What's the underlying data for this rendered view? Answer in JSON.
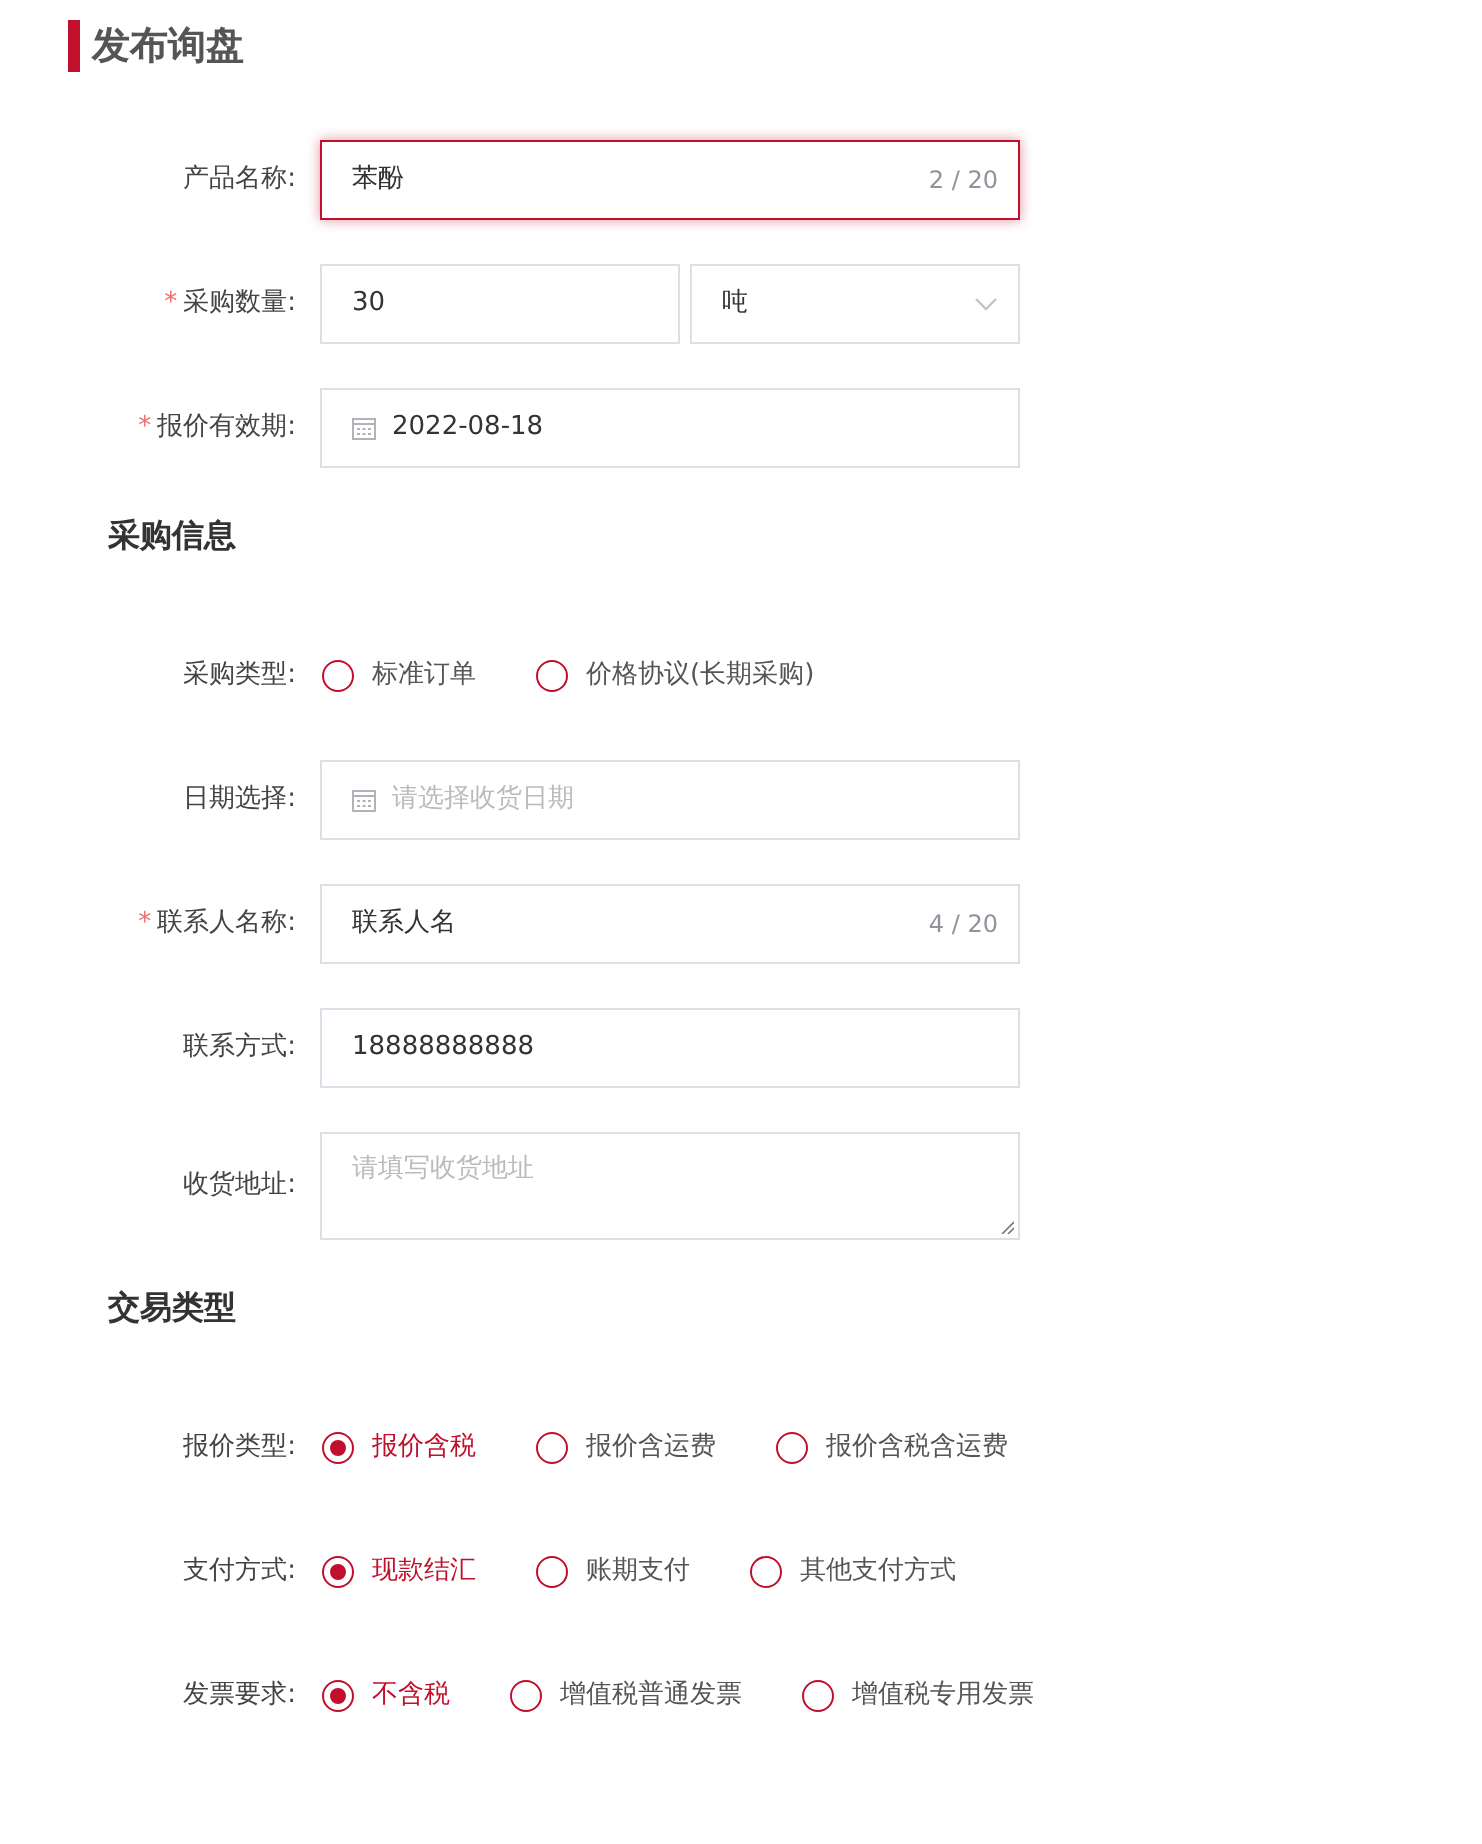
{
  "title": "发布询盘",
  "sections": [
    {
      "rows": [
        {
          "kind": "text",
          "label": "产品名称:",
          "value": "苯酚",
          "counter": "2 / 20",
          "focused": true
        },
        {
          "kind": "quantity",
          "required_mark": "*",
          "label": "采购数量:",
          "value": "30",
          "unit": "吨"
        },
        {
          "kind": "date",
          "required_mark": "*",
          "label": "报价有效期:",
          "value": "2022-08-18"
        }
      ]
    },
    {
      "heading": "采购信息",
      "rows": [
        {
          "kind": "radio",
          "label": "采购类型:",
          "options": [
            {
              "label": "标准订单",
              "selected": false
            },
            {
              "label": "价格协议(长期采购)",
              "selected": false
            }
          ]
        },
        {
          "kind": "date",
          "label": "日期选择:",
          "placeholder": "请选择收货日期"
        },
        {
          "kind": "text",
          "required_mark": "*",
          "label": "联系人名称:",
          "value": "联系人名",
          "counter": "4 / 20",
          "focused": false
        },
        {
          "kind": "text",
          "label": "联系方式:",
          "value": "18888888888",
          "focused": false
        },
        {
          "kind": "textarea",
          "label": "收货地址:",
          "placeholder": "请填写收货地址"
        }
      ]
    },
    {
      "heading": "交易类型",
      "rows": [
        {
          "kind": "radio",
          "label": "报价类型:",
          "options": [
            {
              "label": "报价含税",
              "selected": true
            },
            {
              "label": "报价含运费",
              "selected": false
            },
            {
              "label": "报价含税含运费",
              "selected": false
            }
          ]
        },
        {
          "kind": "radio",
          "label": "支付方式:",
          "options": [
            {
              "label": "现款结汇",
              "selected": true
            },
            {
              "label": "账期支付",
              "selected": false
            },
            {
              "label": "其他支付方式",
              "selected": false
            }
          ]
        },
        {
          "kind": "radio",
          "label": "发票要求:",
          "options": [
            {
              "label": "不含税",
              "selected": true
            },
            {
              "label": "增值税普通发票",
              "selected": false
            },
            {
              "label": "增值税专用发票",
              "selected": false
            }
          ]
        }
      ]
    }
  ]
}
